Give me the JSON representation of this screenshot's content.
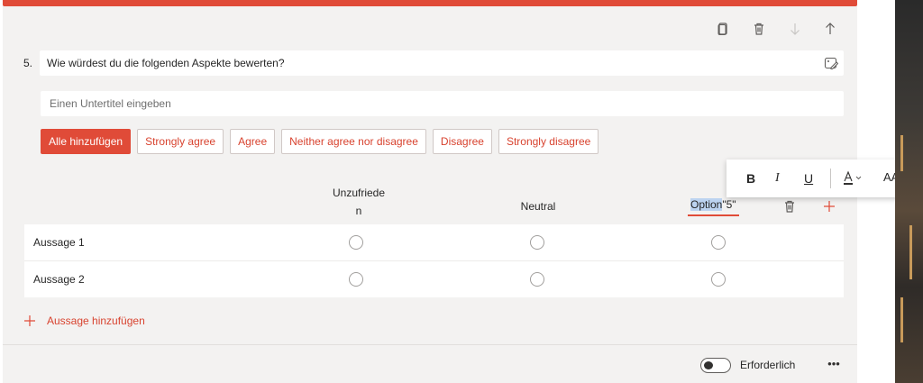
{
  "question": {
    "number": "5.",
    "text": "Wie würdest du die folgenden Aspekte bewerten?",
    "subtitle_placeholder": "Einen Untertitel eingeben"
  },
  "chips": [
    "Alle hinzufügen",
    "Strongly agree",
    "Agree",
    "Neither agree nor disagree",
    "Disagree",
    "Strongly disagree"
  ],
  "columns": {
    "col1_line1": "Unzufriede",
    "col1_line2": "n",
    "col2": "Neutral",
    "col3_selected": "Option",
    "col3_rest": " \"5\""
  },
  "rows": [
    "Aussage 1",
    "Aussage 2"
  ],
  "add_statement": "Aussage hinzufügen",
  "required_label": "Erforderlich",
  "more_label": "•••",
  "format_bar": {
    "bold": "B",
    "italic": "I",
    "underline": "U",
    "font_size": "AA"
  },
  "colors": {
    "accent": "#e04b38",
    "background": "#f3f2f1"
  },
  "icons": [
    "copy-icon",
    "delete-icon",
    "move-down-icon",
    "move-up-icon",
    "edit-image-icon",
    "plus-icon",
    "font-color-icon"
  ]
}
